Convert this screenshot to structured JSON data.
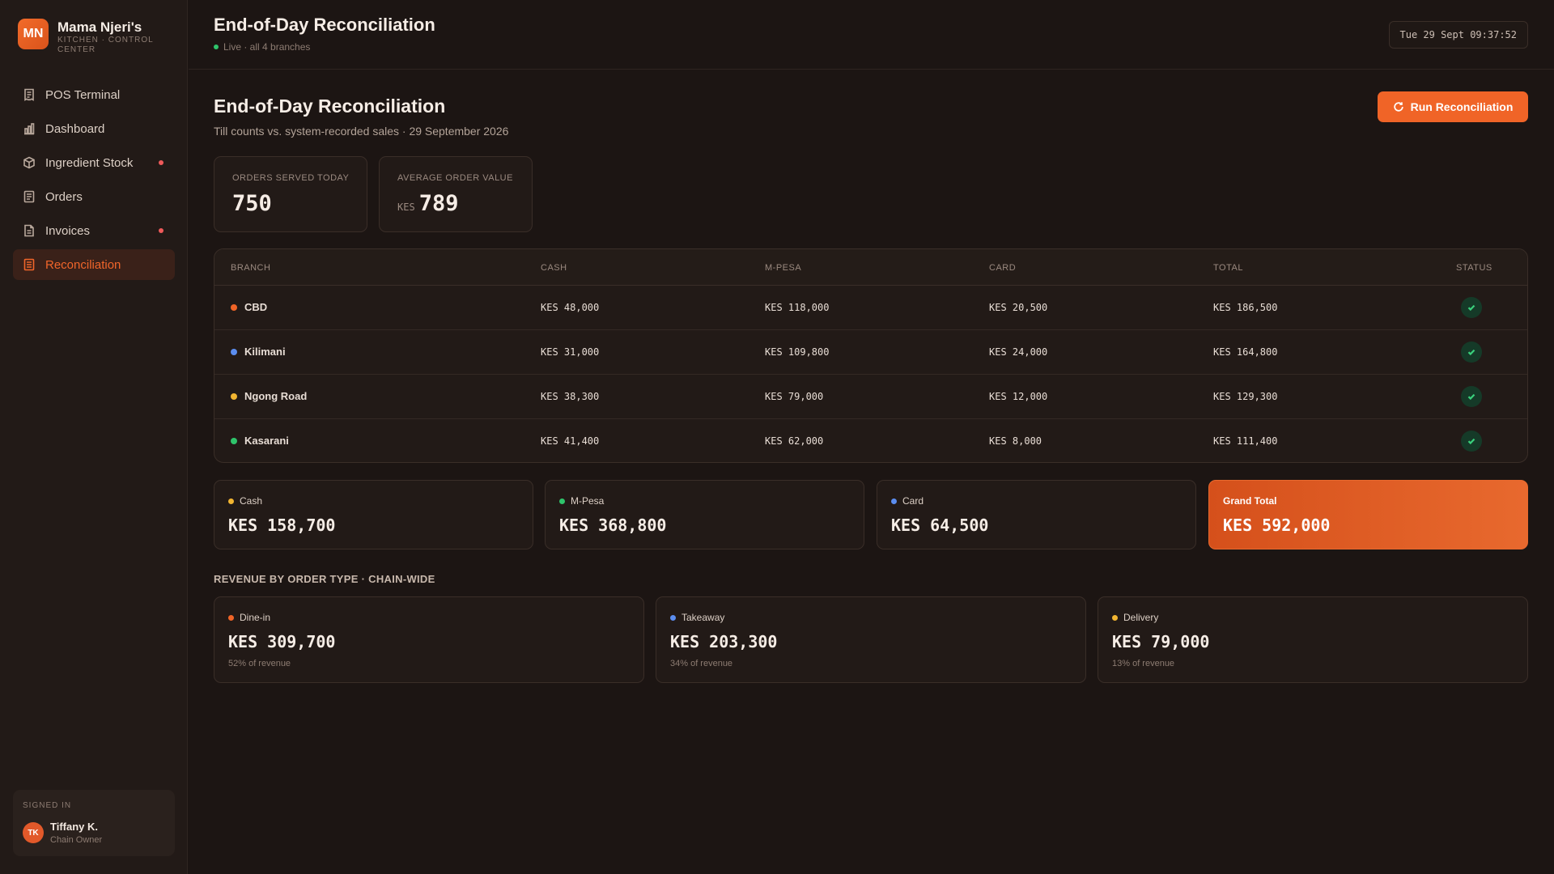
{
  "brand": {
    "initials": "MN",
    "name": "Mama Njeri's",
    "subtitle": "KITCHEN · CONTROL CENTER"
  },
  "nav": [
    {
      "label": "POS Terminal",
      "icon": "receipt-icon",
      "dot": false,
      "active": false
    },
    {
      "label": "Dashboard",
      "icon": "bar-chart-icon",
      "dot": false,
      "active": false
    },
    {
      "label": "Ingredient Stock",
      "icon": "box-icon",
      "dot": true,
      "active": false
    },
    {
      "label": "Orders",
      "icon": "list-icon",
      "dot": false,
      "active": false
    },
    {
      "label": "Invoices",
      "icon": "document-icon",
      "dot": true,
      "active": false
    },
    {
      "label": "Reconciliation",
      "icon": "ledger-icon",
      "dot": false,
      "active": true
    }
  ],
  "user": {
    "label": "SIGNED IN",
    "initials": "TK",
    "name": "Tiffany K.",
    "role": "Chain Owner"
  },
  "topbar": {
    "title": "End-of-Day Reconciliation",
    "live": "Live · all 4 branches",
    "clock": "Tue 29 Sept 09:37:52"
  },
  "page": {
    "title": "End-of-Day Reconciliation",
    "subtitle": "Till counts vs. system-recorded sales · 29 September 2026",
    "run_button": "Run Reconciliation"
  },
  "kpis": {
    "orders": {
      "label": "ORDERS SERVED TODAY",
      "value": "750"
    },
    "aov": {
      "label": "AVERAGE ORDER VALUE",
      "unit": "KES",
      "value": "789"
    }
  },
  "table": {
    "headers": {
      "branch": "BRANCH",
      "cash": "CASH",
      "mpesa": "M-PESA",
      "card": "CARD",
      "total": "TOTAL",
      "status": "STATUS"
    },
    "rows": [
      {
        "branch": "CBD",
        "color": "#f06427",
        "cash": "KES 48,000",
        "mpesa": "KES 118,000",
        "card": "KES 20,500",
        "total": "KES 186,500",
        "status": "reconciled"
      },
      {
        "branch": "Kilimani",
        "color": "#5b8def",
        "cash": "KES 31,000",
        "mpesa": "KES 109,800",
        "card": "KES 24,000",
        "total": "KES 164,800",
        "status": "reconciled"
      },
      {
        "branch": "Ngong Road",
        "color": "#f2b531",
        "cash": "KES 38,300",
        "mpesa": "KES 79,000",
        "card": "KES 12,000",
        "total": "KES 129,300",
        "status": "reconciled"
      },
      {
        "branch": "Kasarani",
        "color": "#2fc46b",
        "cash": "KES 41,400",
        "mpesa": "KES 62,000",
        "card": "KES 8,000",
        "total": "KES 111,400",
        "status": "reconciled"
      }
    ]
  },
  "totals": [
    {
      "label": "Cash",
      "color": "#f2b531",
      "value": "KES 158,700"
    },
    {
      "label": "M-Pesa",
      "color": "#2fc46b",
      "value": "KES 368,800"
    },
    {
      "label": "Card",
      "color": "#5b8def",
      "value": "KES 64,500"
    },
    {
      "label": "Grand Total",
      "color": "",
      "value": "KES 592,000"
    }
  ],
  "revenue": {
    "title": "REVENUE BY ORDER TYPE · CHAIN-WIDE",
    "items": [
      {
        "label": "Dine-in",
        "color": "#f06427",
        "value": "KES 309,700",
        "pct": "52% of revenue"
      },
      {
        "label": "Takeaway",
        "color": "#5b8def",
        "value": "KES 203,300",
        "pct": "34% of revenue"
      },
      {
        "label": "Delivery",
        "color": "#f2b531",
        "value": "KES 79,000",
        "pct": "13% of revenue"
      }
    ]
  }
}
